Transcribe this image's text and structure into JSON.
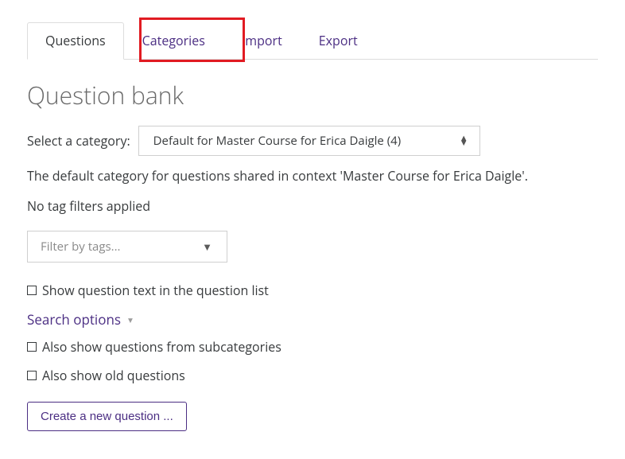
{
  "tabs": {
    "questions": "Questions",
    "categories": "Categories",
    "import": "Import",
    "export": "Export"
  },
  "page_title": "Question bank",
  "category_select": {
    "label": "Select a category:",
    "value": "Default for Master Course for Erica Daigle (4)"
  },
  "description": "The default category for questions shared in context 'Master Course for Erica Daigle'.",
  "tag_filter_status": "No tag filters applied",
  "filter_placeholder": "Filter by tags...",
  "checkboxes": {
    "show_question_text": "Show question text in the question list",
    "show_subcategories": "Also show questions from subcategories",
    "show_old": "Also show old questions"
  },
  "search_options_label": "Search options",
  "create_button": "Create a new question ...",
  "highlight_target": "categories-tab"
}
